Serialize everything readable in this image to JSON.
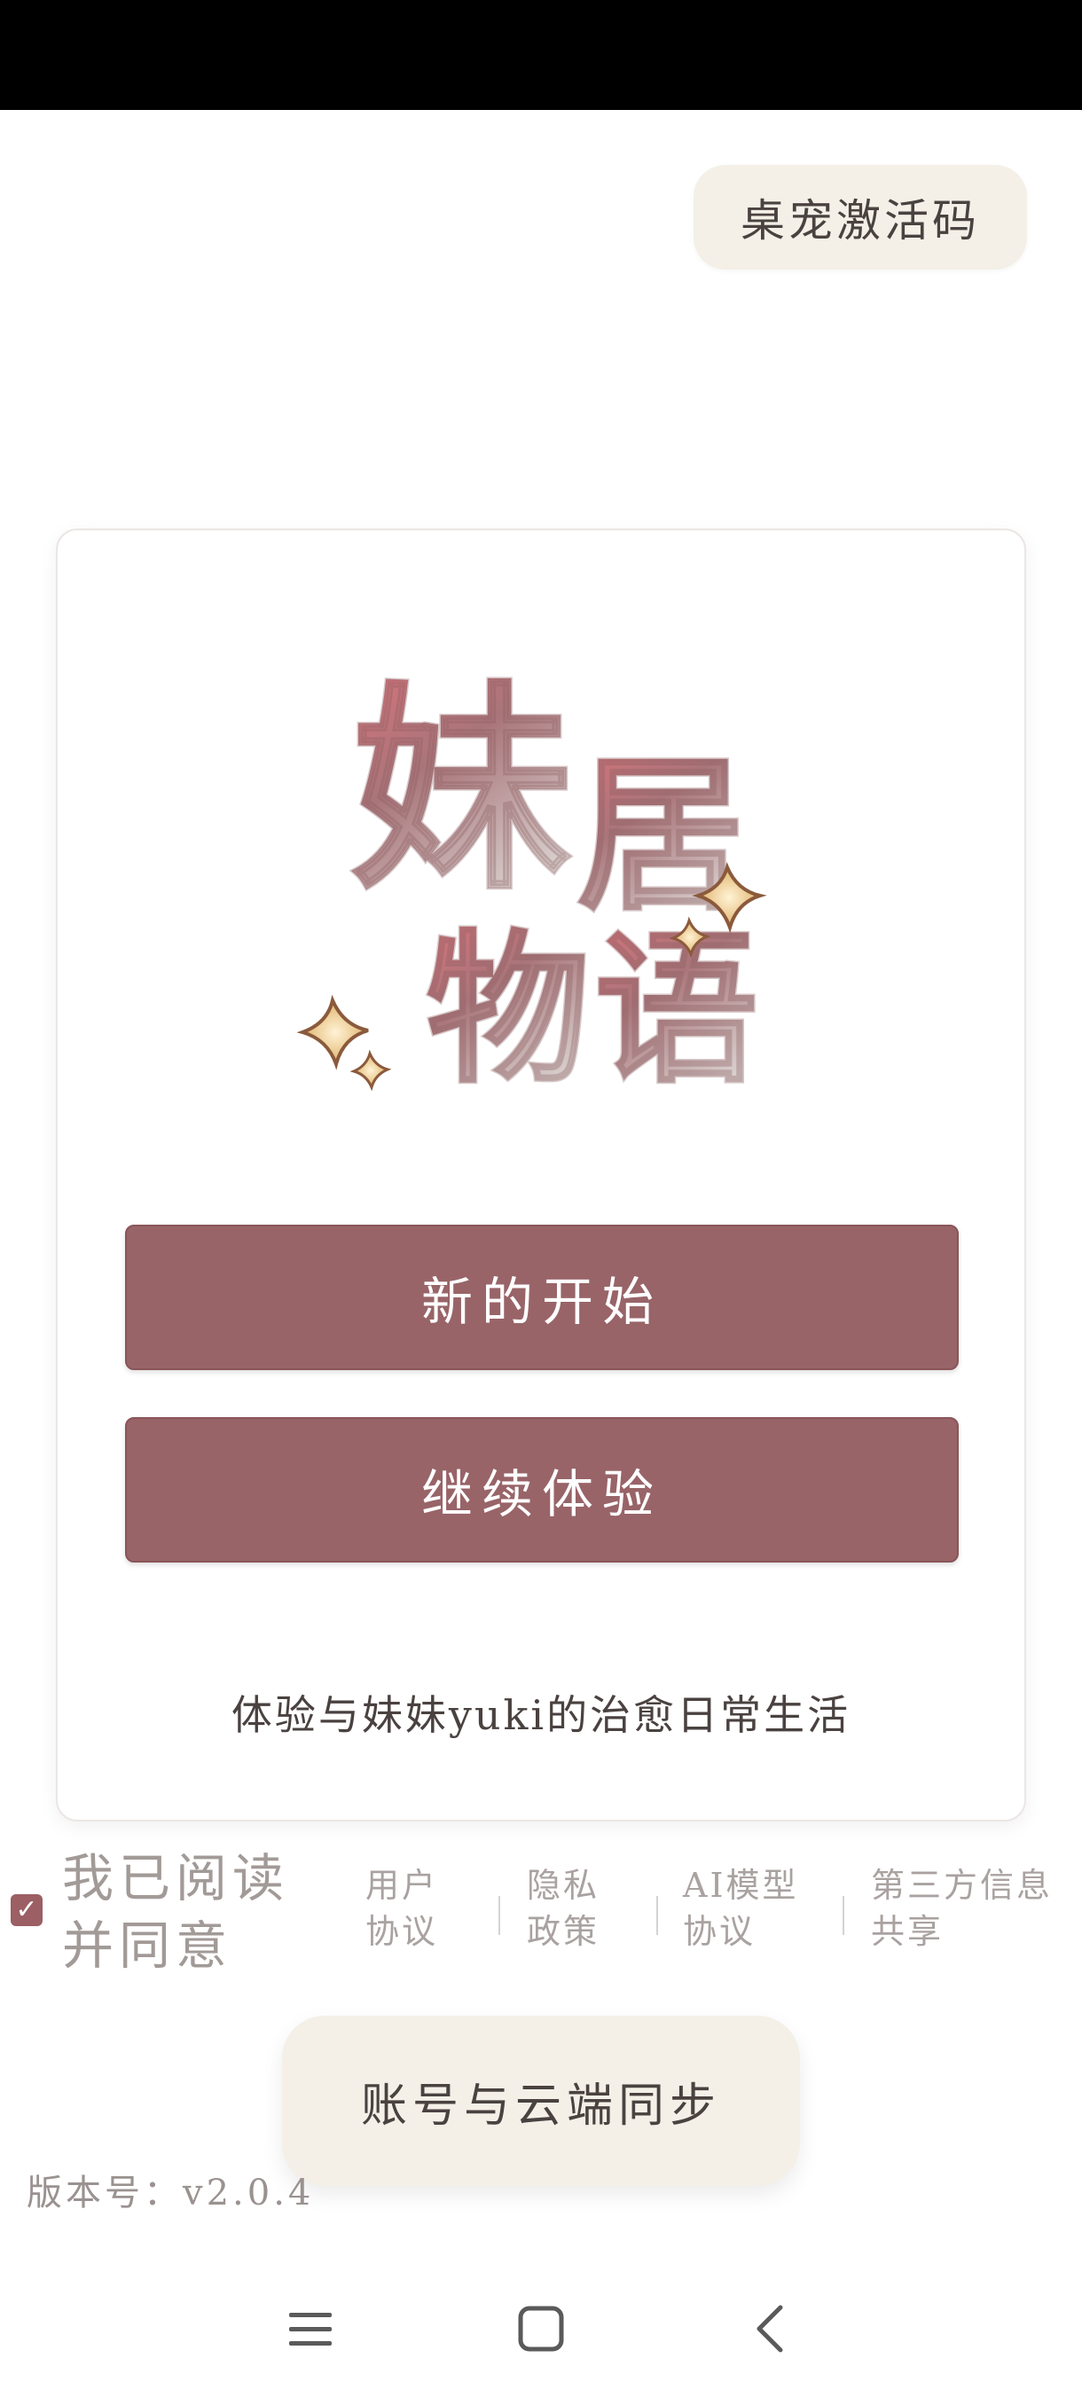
{
  "activation_button": "桌宠激活码",
  "logo": {
    "text": "妹居物语"
  },
  "card": {
    "new_start_button": "新的开始",
    "continue_button": "继续体验",
    "tagline": "体验与妹妹yuki的治愈日常生活"
  },
  "agreement": {
    "checked": true,
    "label": "我已阅读并同意",
    "links": {
      "user_agreement": "用户协议",
      "privacy_policy": "隐私政策",
      "ai_model_agreement": "AI模型协议",
      "third_party_sharing": "第三方信息共享"
    }
  },
  "sync_button": "账号与云端同步",
  "version": "版本号：v2.0.4",
  "colors": {
    "button_primary": "#986468",
    "button_soft": "#f4f0e7",
    "logo_gradient_top": "#d9737a",
    "logo_gradient_bottom": "#cfc6c4",
    "sparkle": "#e8c27a"
  },
  "nav_icons": [
    "menu-icon",
    "home-icon",
    "back-icon"
  ]
}
